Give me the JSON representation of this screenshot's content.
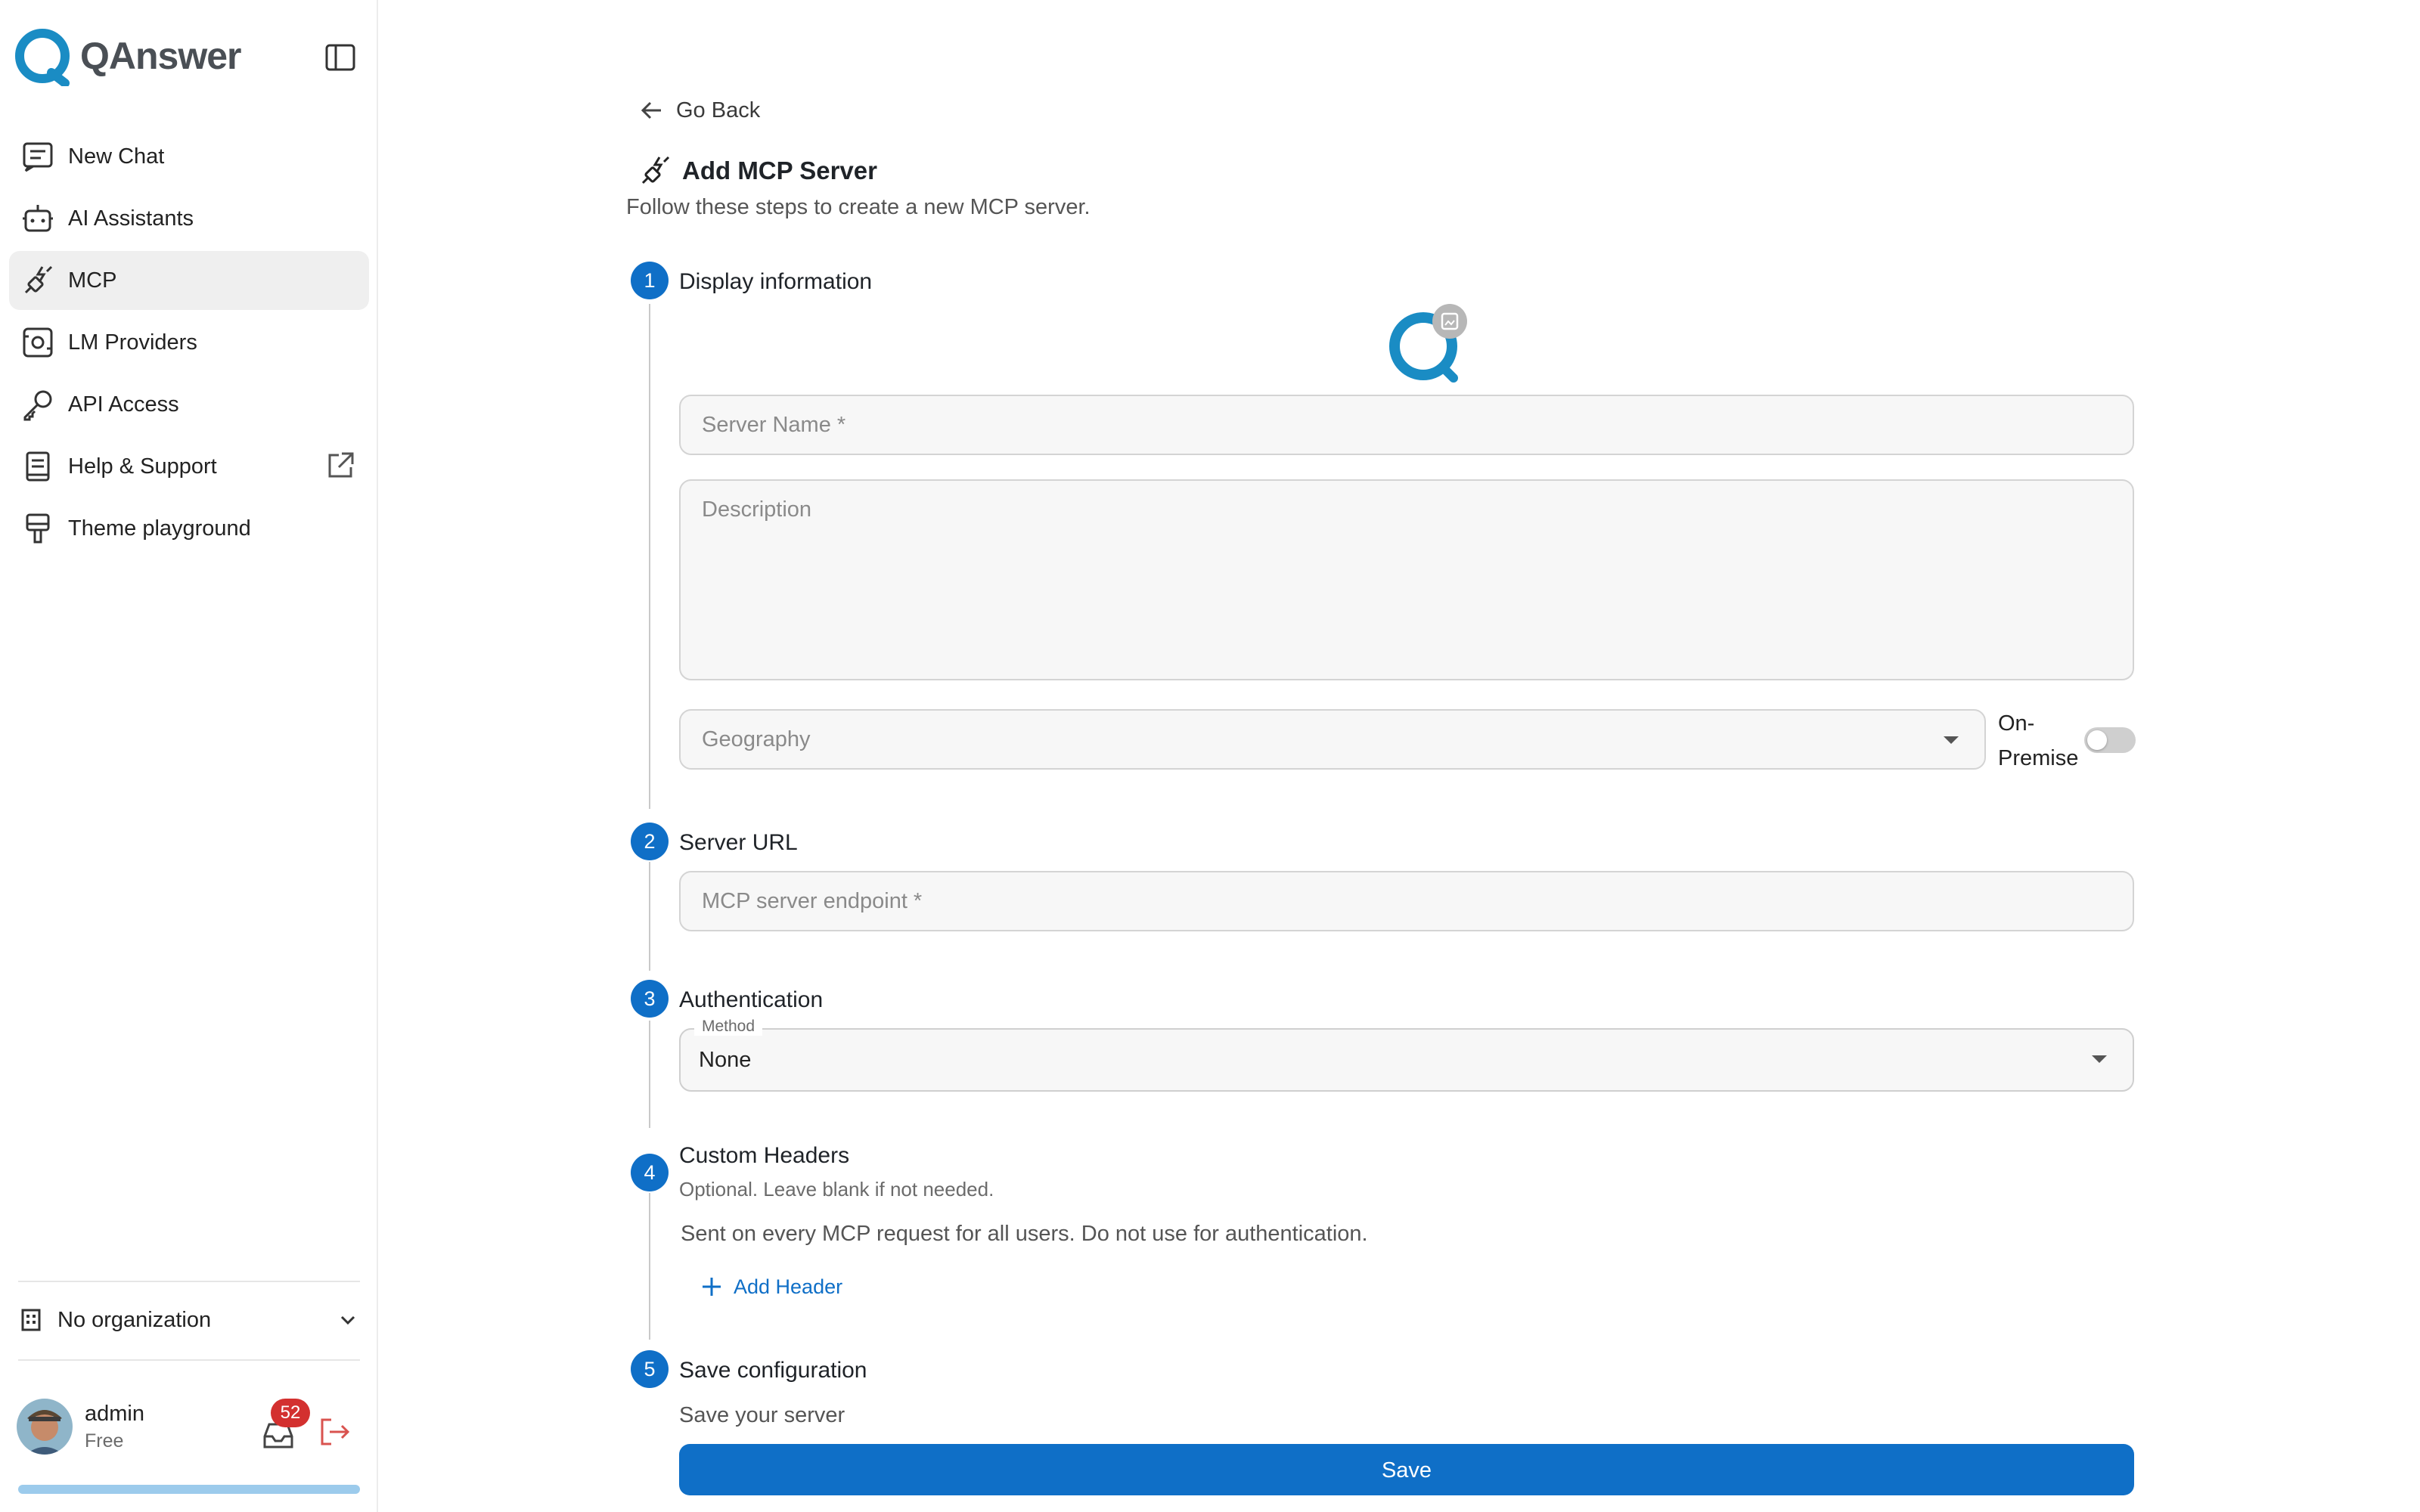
{
  "brand": {
    "name": "QAnswer"
  },
  "sidebar": {
    "items": [
      {
        "label": "New Chat",
        "icon": "chat-icon"
      },
      {
        "label": "AI Assistants",
        "icon": "robot-icon"
      },
      {
        "label": "MCP",
        "icon": "plug-icon",
        "active": true
      },
      {
        "label": "LM Providers",
        "icon": "chip-icon"
      },
      {
        "label": "API Access",
        "icon": "key-icon"
      },
      {
        "label": "Help & Support",
        "icon": "book-icon"
      },
      {
        "label": "Theme playground",
        "icon": "paint-brush-icon"
      }
    ],
    "organization": "No organization",
    "user": {
      "name": "admin",
      "plan": "Free",
      "notifications": "52"
    },
    "usage_fraction": 1.0
  },
  "main": {
    "back_label": "Go Back",
    "title": "Add MCP Server",
    "subtitle": "Follow these steps to create a new MCP server.",
    "steps": [
      {
        "num": "1",
        "title": "Display information"
      },
      {
        "num": "2",
        "title": "Server URL"
      },
      {
        "num": "3",
        "title": "Authentication"
      },
      {
        "num": "4",
        "title": "Custom Headers",
        "desc": "Optional. Leave blank if not needed."
      },
      {
        "num": "5",
        "title": "Save configuration",
        "desc": "Save your server"
      }
    ],
    "server_name_placeholder": "Server Name",
    "required_mark": "*",
    "description_placeholder": "Description",
    "geography_placeholder": "Geography",
    "on_premise_label": "On-Premise",
    "on_premise_enabled": false,
    "endpoint_placeholder": "MCP server endpoint",
    "method_label": "Method",
    "method_value": "None",
    "headers_note": "Sent on every MCP request for all users. Do not use for authentication.",
    "add_header_label": "Add Header",
    "save_label": "Save"
  },
  "colors": {
    "accent": "#0f6fc7",
    "brand": "#1a8cc4",
    "badge": "#d3302f",
    "logout": "#d9534f"
  }
}
